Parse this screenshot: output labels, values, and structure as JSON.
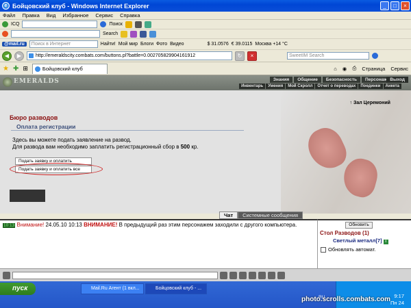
{
  "window": {
    "title": "Бойцовский клуб - Windows Internet Explorer"
  },
  "menu": [
    "Файл",
    "Правка",
    "Вид",
    "Избранное",
    "Сервис",
    "Справка"
  ],
  "toolbar1": {
    "icq": "ICQ",
    "poisk": "Поиск"
  },
  "toolbar2": {
    "search": "Search"
  },
  "toolbar3": {
    "mail": "@mail.ru",
    "search_placeholder": "Поиск в Интернет",
    "find": "Найти!",
    "moimir": "Мой мир",
    "blogi": "Блоги",
    "foto": "Фото",
    "video": "Видео",
    "usd": "$ 31.0576",
    "eur": "€ 39.0115",
    "weather": "Москва +14 °C"
  },
  "address": {
    "url": "http://emeraldscity.combats.com/buttons.pl?battle=0.002705829904161912",
    "search_placeholder": "SweetIM Search"
  },
  "tabs": {
    "tab1": "Бойцовский клуб",
    "page": "Страница",
    "service": "Сервис"
  },
  "game": {
    "logo": "EMERALDS",
    "nav1": [
      "Знания",
      "Общение",
      "Безопасность",
      "Персонаж"
    ],
    "exit": "Выход",
    "nav2": [
      "Инвентарь",
      "Умения",
      "Мой Скролл",
      "Отчет о переводах",
      "Поединки",
      "Анкета"
    ],
    "zal": "Зал Церемоний"
  },
  "page": {
    "title": "Бюро разводов",
    "subtitle": "Оплата регистрации",
    "line1": "Здесь вы можете подать заявление на развод.",
    "line2_pre": "Для развода вам необходимо заплатить регистрационный сбор в ",
    "fee": "500",
    "line2_post": " кр.",
    "btn_half": "Подать заявку и оплатить половину",
    "btn_all": "Подать заявку и оплатить все"
  },
  "chat": {
    "tab_chat": "Чат",
    "tab_sys": "Системные сообщения",
    "time": "10:13",
    "warn1": "Внимание!",
    "date": " 24.05.10 10:13 ",
    "warn2": "ВНИМАНИЕ!",
    "msg": " В предыдущий раз этим персонажем заходили с другого компьютера."
  },
  "side": {
    "refresh": "Обновить",
    "table": "Стол Разводов (1)",
    "player": "Светлый металл",
    "level": "[7]",
    "auto": "Обновлять автомат."
  },
  "taskbar": {
    "start": "пуск",
    "task1": "Mail.Ru Агент (1 вкл...",
    "task2": "Бойцовский клуб - ...",
    "clock": "9:17",
    "day": "Пн 24",
    "lang": "RU"
  },
  "watermark": "photo.scrolls.combats.com"
}
